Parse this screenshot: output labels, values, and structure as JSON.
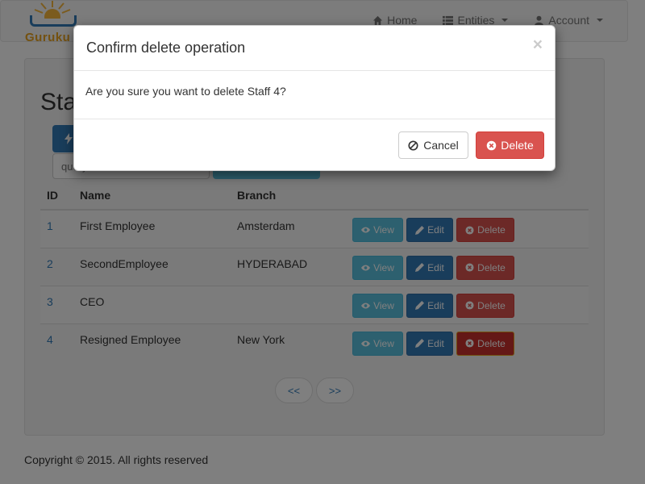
{
  "brand": {
    "name": "Guruku"
  },
  "nav": {
    "items": [
      {
        "label": "Home",
        "icon": "home-icon",
        "dropdown": false
      },
      {
        "label": "Entities",
        "icon": "list-icon",
        "dropdown": true
      },
      {
        "label": "Account",
        "icon": "user-icon",
        "dropdown": true
      }
    ]
  },
  "page": {
    "title": "Staff",
    "search_placeholder": "query"
  },
  "table": {
    "headers": {
      "id": "ID",
      "name": "Name",
      "branch": "Branch"
    },
    "rows": [
      {
        "id": "1",
        "name": "First Employee",
        "branch": "Amsterdam"
      },
      {
        "id": "2",
        "name": "SecondEmployee",
        "branch": "HYDERABAD"
      },
      {
        "id": "3",
        "name": "CEO",
        "branch": ""
      },
      {
        "id": "4",
        "name": "Resigned Employee",
        "branch": "New York"
      }
    ],
    "actions": {
      "view": "View",
      "edit": "Edit",
      "delete": "Delete"
    }
  },
  "pager": {
    "prev": "<<",
    "next": ">>"
  },
  "footer": {
    "copyright": "Copyright © 2015. All rights reserved"
  },
  "modal": {
    "title": "Confirm delete operation",
    "close": "×",
    "message": "Are you sure you want to delete Staff 4?",
    "cancel_label": "Cancel",
    "delete_label": "Delete"
  },
  "colors": {
    "primary": "#337ab7",
    "info": "#5bc0de",
    "danger": "#d9534f",
    "brand": "#e8a320"
  }
}
